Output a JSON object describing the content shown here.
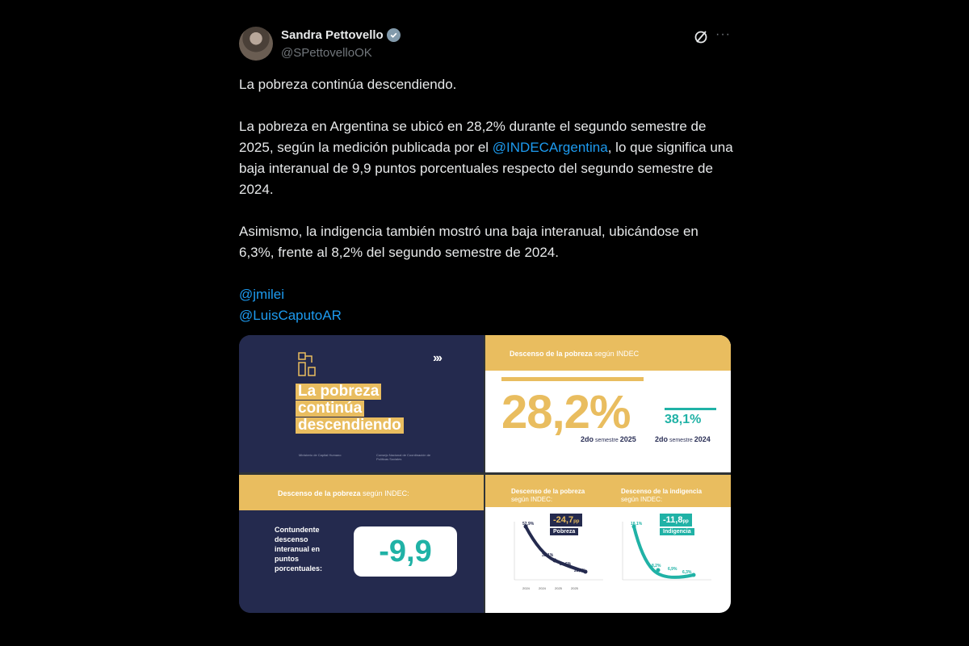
{
  "author": {
    "name": "Sandra Pettovello",
    "handle": "@SPettovelloOK"
  },
  "post": {
    "line1": "La pobreza continúa descendiendo.",
    "para2_pre": "La pobreza en Argentina se ubicó en 28,2% durante el segundo semestre de 2025, según la medición publicada por el ",
    "para2_mention": "@INDECArgentina",
    "para2_post": ", lo que significa una baja interanual de 9,9 puntos porcentuales respecto del segundo semestre de 2024.",
    "para3": "Asimismo, la indigencia también mostró una baja interanual, ubicándose en 6,3%, frente al 8,2% del segundo semestre de 2024.",
    "mention1": "@jmilei",
    "mention2": "@LuisCaputoAR"
  },
  "media": {
    "tile1": {
      "line1": "La pobreza",
      "line2": "continúa",
      "line3": "descendiendo",
      "arrows": "›››",
      "ministry": "Ministerio de Capital Humano",
      "council": "Consejo Nacional de Coordinación de Políticas Sociales"
    },
    "tile2": {
      "band_bold": "Descenso de la pobreza",
      "band_rest": " según INDEC",
      "big": "28,2%",
      "small": "38,1%",
      "label_a_bold": "2do",
      "label_a_mid": " semestre ",
      "label_a_year": "2025",
      "label_b_bold": "2do",
      "label_b_mid": " semestre ",
      "label_b_year": "2024"
    },
    "tile3": {
      "band_bold": "Descenso de la pobreza",
      "band_rest": " según INDEC:",
      "text": "Contundente descenso interanual en puntos porcentuales:",
      "value": "-9,9"
    },
    "tile4": {
      "left_title": "Descenso de la pobreza",
      "left_sub": "según INDEC:",
      "left_badge": "-24,7",
      "left_badge_unit": "pp",
      "left_label": "Pobreza",
      "right_title": "Descenso de la indigencia",
      "right_sub": "según INDEC:",
      "right_badge": "-11,8",
      "right_badge_unit": "pp",
      "right_label": "Indigencia",
      "left_points": [
        "52,9%",
        "38,1%",
        "31,6%",
        "28,2%"
      ],
      "right_points": [
        "18,1%",
        "8,2%",
        "6,9%",
        "6,3%"
      ],
      "x_years": [
        "2024",
        "2024",
        "2025",
        "2025"
      ]
    }
  },
  "colors": {
    "accent": "#1d9bf0",
    "gold": "#e9bd5f",
    "navy": "#242a4e",
    "teal": "#20b2a6"
  }
}
